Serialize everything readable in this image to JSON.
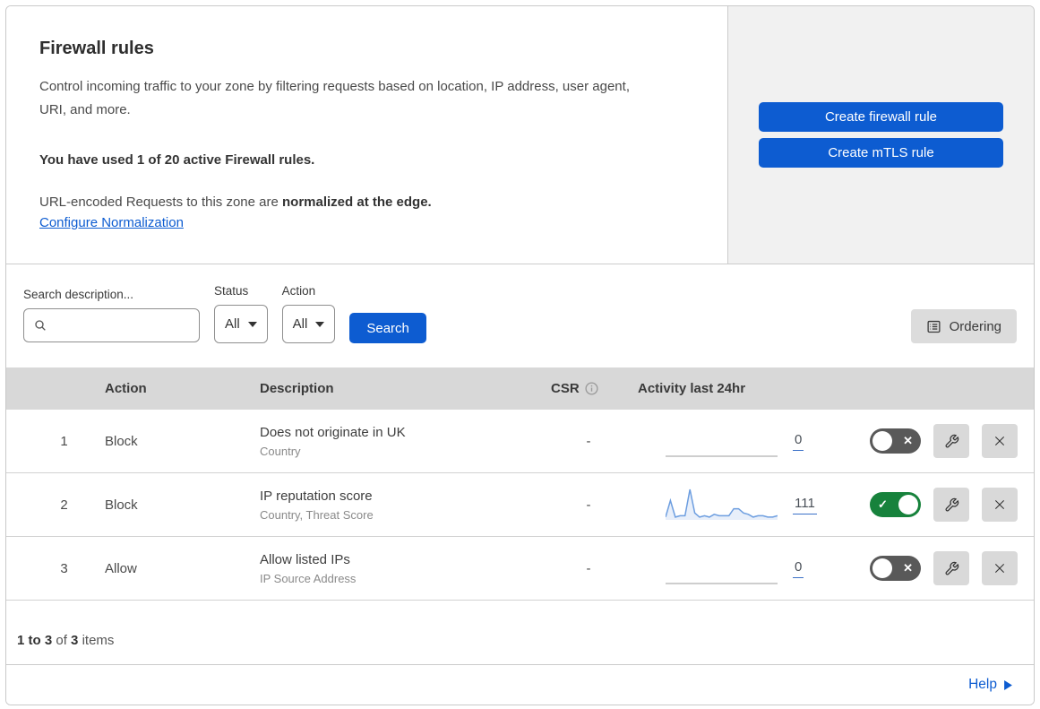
{
  "colors": {
    "primary_blue": "#0d5cd1",
    "toggle_on_green": "#17823c",
    "toggle_off_gray": "#595959",
    "sparkline_blue": "#6d9ee0",
    "side_panel_gray": "#f1f1f1",
    "table_header_gray": "#d8d8d8"
  },
  "header": {
    "title": "Firewall rules",
    "description": "Control incoming traffic to your zone by filtering requests based on location, IP address, user agent, URI, and more.",
    "usage_notice": "You have used 1 of 20 active Firewall rules.",
    "normalization_text": "URL-encoded Requests to this zone are ",
    "normalization_bold": "normalized at the edge.",
    "normalization_link": "Configure Normalization",
    "create_firewall_button": "Create firewall rule",
    "create_mtls_button": "Create mTLS rule"
  },
  "filters": {
    "search_label": "Search description...",
    "status_label": "Status",
    "status_value": "All",
    "action_label": "Action",
    "action_value": "All",
    "search_button": "Search",
    "ordering_button": "Ordering"
  },
  "table": {
    "headers": {
      "action": "Action",
      "description": "Description",
      "csr": "CSR",
      "activity": "Activity last 24hr"
    },
    "rows": [
      {
        "priority": "1",
        "action": "Block",
        "description": "Does not originate in UK",
        "match_fields": "Country",
        "csr": "-",
        "activity_count": "0",
        "enabled": false,
        "sparkline": [
          0,
          0,
          0,
          0,
          0,
          0,
          0,
          0,
          0,
          0,
          0,
          0,
          0,
          0,
          0,
          0,
          0,
          0,
          0,
          0,
          0,
          0,
          0,
          0
        ]
      },
      {
        "priority": "2",
        "action": "Block",
        "description": "IP reputation score",
        "match_fields": "Country, Threat Score",
        "csr": "-",
        "activity_count": "111",
        "enabled": true,
        "sparkline": [
          2,
          14,
          2,
          3,
          3,
          22,
          5,
          2,
          3,
          2,
          4,
          3,
          3,
          3,
          8,
          8,
          5,
          4,
          2,
          3,
          3,
          2,
          2,
          3
        ]
      },
      {
        "priority": "3",
        "action": "Allow",
        "description": "Allow listed IPs",
        "match_fields": "IP Source Address",
        "csr": "-",
        "activity_count": "0",
        "enabled": false,
        "sparkline": [
          0,
          0,
          0,
          0,
          0,
          0,
          0,
          0,
          0,
          0,
          0,
          0,
          0,
          0,
          0,
          0,
          0,
          0,
          0,
          0,
          0,
          0,
          0,
          0
        ]
      }
    ]
  },
  "footer": {
    "range": "1 to 3",
    "of_text": "of",
    "total": "3",
    "items_text": "items",
    "help_link": "Help"
  }
}
